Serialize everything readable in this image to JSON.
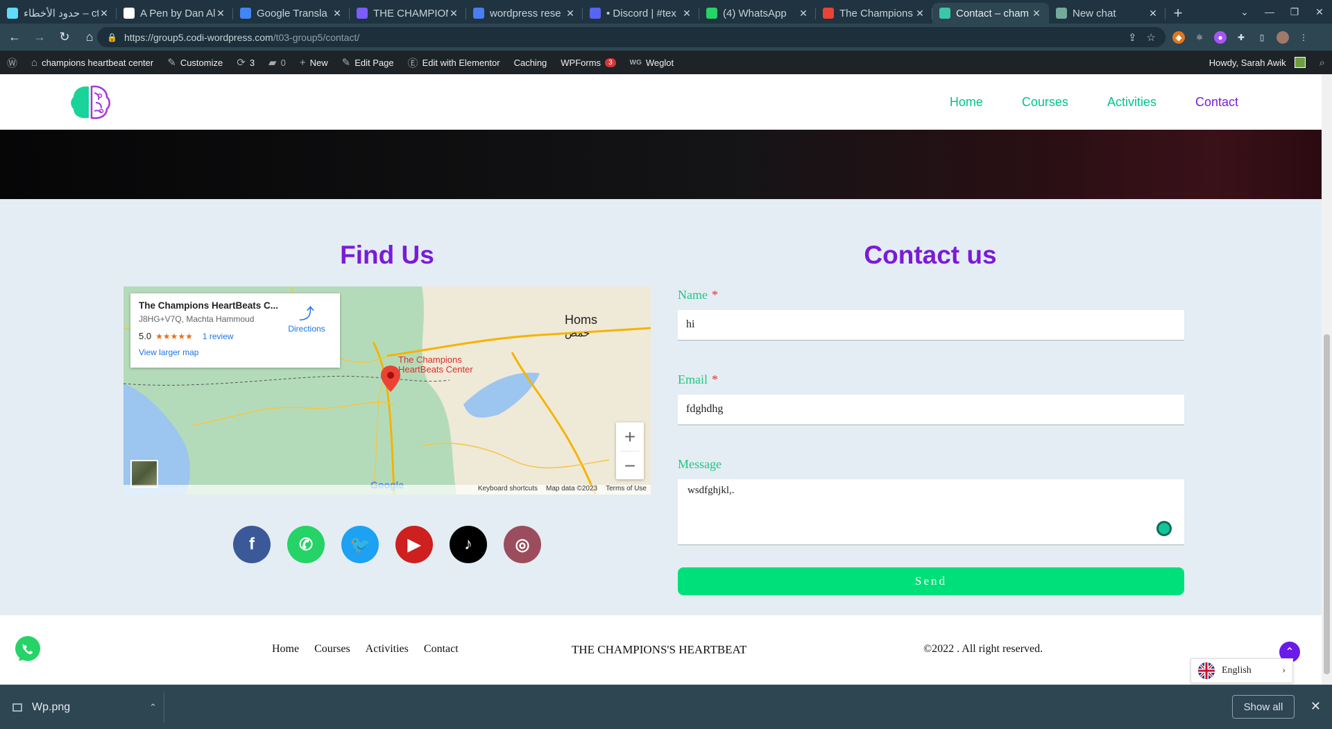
{
  "browser": {
    "tabs": [
      {
        "title": "حدود الأخطاء – ct",
        "color": "#61dafb",
        "active": false
      },
      {
        "title": "A Pen by Dan Al",
        "color": "#ffffff",
        "active": false
      },
      {
        "title": "Google Transla",
        "color": "#4285f4",
        "active": false
      },
      {
        "title": "THE CHAMPION",
        "color": "#7a5cff",
        "active": false
      },
      {
        "title": "wordpress rese",
        "color": "#4a7df0",
        "active": false
      },
      {
        "title": "• Discord | #tex",
        "color": "#5865f2",
        "active": false
      },
      {
        "title": "(4) WhatsApp",
        "color": "#25d366",
        "active": false
      },
      {
        "title": "The Champions",
        "color": "#ea4335",
        "active": false
      },
      {
        "title": "Contact – cham",
        "color": "#3cc6a7",
        "active": true
      },
      {
        "title": "New chat",
        "color": "#74aa9c",
        "active": false
      }
    ],
    "url_host": "https://group5.codi-wordpress.com",
    "url_path": "/t03-group5/contact/"
  },
  "wpadmin": {
    "site_name": "champions heartbeat center",
    "customize": "Customize",
    "updates_count": "3",
    "comments_count": "0",
    "new": "New",
    "edit_page": "Edit Page",
    "edit_elementor": "Edit with Elementor",
    "caching": "Caching",
    "wpforms": "WPForms",
    "wpforms_badge": "3",
    "weglot": "Weglot",
    "weglot_prefix": "WG",
    "howdy": "Howdy, Sarah Awik"
  },
  "site_nav": {
    "items": [
      "Home",
      "Courses",
      "Activities",
      "Contact"
    ],
    "current": "Contact"
  },
  "find_us": {
    "heading": "Find Us",
    "map": {
      "place_name": "The Champions HeartBeats C...",
      "address": "J8HG+V7Q, Machta Hammoud",
      "rating": "5.0",
      "stars": "★★★★★",
      "reviews": "1 review",
      "larger_map": "View larger map",
      "directions": "Directions",
      "pin_label_1": "The Champions",
      "pin_label_2": "HeartBeats Center",
      "city": "Homs",
      "city_ar": "حمص",
      "attribution_shortcuts": "Keyboard shortcuts",
      "attribution_data": "Map data ©2023",
      "attribution_terms": "Terms of Use",
      "google": "Google"
    },
    "social": [
      {
        "name": "facebook",
        "color": "#3b5998",
        "glyph": "f"
      },
      {
        "name": "whatsapp",
        "color": "#25d366",
        "glyph": "✆"
      },
      {
        "name": "twitter",
        "color": "#1da1f2",
        "glyph": "🐦"
      },
      {
        "name": "youtube",
        "color": "#cd201f",
        "glyph": "▶"
      },
      {
        "name": "tiktok",
        "color": "#000000",
        "glyph": "♪"
      },
      {
        "name": "instagram",
        "color": "#9b4d5d",
        "glyph": "◎"
      }
    ]
  },
  "contact_form": {
    "heading": "Contact us",
    "name_label": "Name",
    "name_value": "hi",
    "email_label": "Email",
    "email_value": "fdghdhg",
    "message_label": "Message",
    "message_value": "wsdfghjkl,.",
    "required_mark": "*",
    "submit": "Send"
  },
  "footer": {
    "nav": [
      "Home",
      "Courses",
      "Activities",
      "Contact"
    ],
    "brand": "THE CHAMPIONS'S HEARTBEAT",
    "copyright": "©2022 . All right reserved.",
    "language": "English"
  },
  "downloads": {
    "file": "Wp.png",
    "show_all": "Show all"
  },
  "colors": {
    "accent_purple": "#7a1bd8",
    "accent_green": "#00c48c",
    "send_green": "#00e07a"
  }
}
